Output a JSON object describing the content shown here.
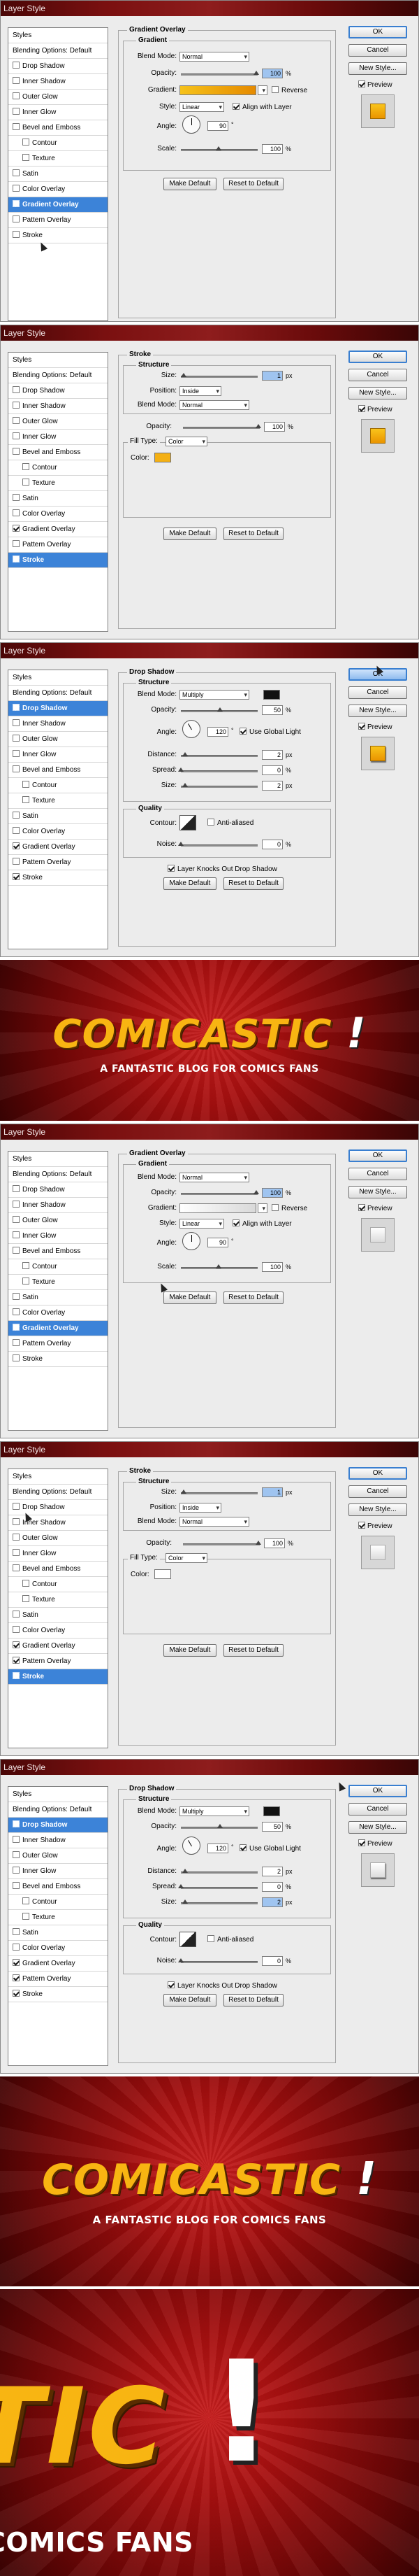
{
  "dialog_title": "Layer Style",
  "buttons": {
    "ok": "OK",
    "cancel": "Cancel",
    "new_style": "New Style...",
    "preview": "Preview"
  },
  "style_list": {
    "styles": "Styles",
    "blending": "Blending Options: Default",
    "items": [
      "Drop Shadow",
      "Inner Shadow",
      "Outer Glow",
      "Inner Glow",
      "Bevel and Emboss",
      "Contour",
      "Texture",
      "Satin",
      "Color Overlay",
      "Gradient Overlay",
      "Pattern Overlay",
      "Stroke"
    ]
  },
  "common": {
    "make_default": "Make Default",
    "reset_default": "Reset to Default"
  },
  "gradient_overlay": {
    "title": "Gradient Overlay",
    "sub": "Gradient",
    "blend_mode_label": "Blend Mode:",
    "blend_mode": "Normal",
    "opacity_label": "Opacity:",
    "opacity": "100",
    "pct": "%",
    "gradient_label": "Gradient:",
    "reverse": "Reverse",
    "style_label": "Style:",
    "style": "Linear",
    "align": "Align with Layer",
    "angle_label": "Angle:",
    "angle": "90",
    "deg": "°",
    "scale_label": "Scale:",
    "scale": "100"
  },
  "stroke": {
    "title": "Stroke",
    "sub": "Structure",
    "size_label": "Size:",
    "size": "1",
    "px": "px",
    "position_label": "Position:",
    "position": "Inside",
    "blend_mode_label": "Blend Mode:",
    "blend_mode": "Normal",
    "opacity_label": "Opacity:",
    "opacity": "100",
    "fill_type_label": "Fill Type:",
    "fill_type": "Color",
    "color_label": "Color:"
  },
  "drop_shadow": {
    "title": "Drop Shadow",
    "sub": "Structure",
    "blend_mode_label": "Blend Mode:",
    "blend_mode": "Multiply",
    "opacity_label": "Opacity:",
    "opacity": "50",
    "angle_label": "Angle:",
    "angle": "120",
    "global_light": "Use Global Light",
    "distance_label": "Distance:",
    "distance": "2",
    "spread_label": "Spread:",
    "spread": "0",
    "size_label": "Size:",
    "size": "2",
    "quality": "Quality",
    "contour_label": "Contour:",
    "anti_aliased": "Anti-aliased",
    "noise_label": "Noise:",
    "noise": "0",
    "knocks_out": "Layer Knocks Out Drop Shadow"
  },
  "banner": {
    "title": "COMICASTIC",
    "bang": "!",
    "subtitle": "A FANTASTIC BLOG FOR COMICS FANS",
    "crop_title": "TIC",
    "crop_sub": "COMICS FANS"
  },
  "colors": {
    "gold": "#f4b014",
    "gold_dark": "#d07a00",
    "white": "#ffffff",
    "select_blue": "#3c83d8",
    "banner_red": "#a81010"
  }
}
